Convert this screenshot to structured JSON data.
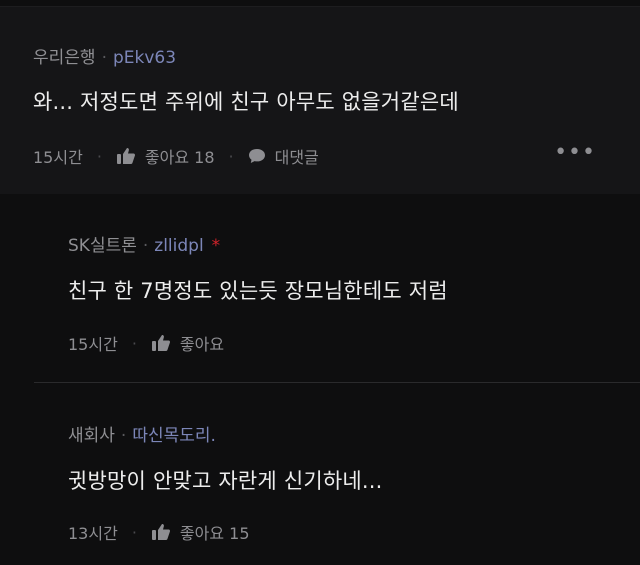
{
  "comments": [
    {
      "author": "우리은행",
      "nickname": "pEkv63",
      "text": "와... 저정도면 주위에 친구 아무도 없을거같은데",
      "time": "15시간",
      "like_label": "좋아요 18",
      "reply_label": "대댓글"
    },
    {
      "author": "SK실트론",
      "nickname": "zllidpl",
      "badge": "*",
      "text": "친구 한 7명정도 있는듯 장모님한테도 저럼",
      "time": "15시간",
      "like_label": "좋아요"
    },
    {
      "author": "새회사",
      "nickname": "따신목도리.",
      "text": "귓방망이 안맞고 자란게 신기하네...",
      "time": "13시간",
      "like_label": "좋아요 15"
    }
  ],
  "icons": {
    "like": "thumbs-up-icon",
    "reply": "speech-bubble-icon",
    "more": "more-options-icon"
  },
  "colors": {
    "background": "#0e0e0f",
    "nickname": "#7c86b8",
    "badge": "#d2232a"
  }
}
